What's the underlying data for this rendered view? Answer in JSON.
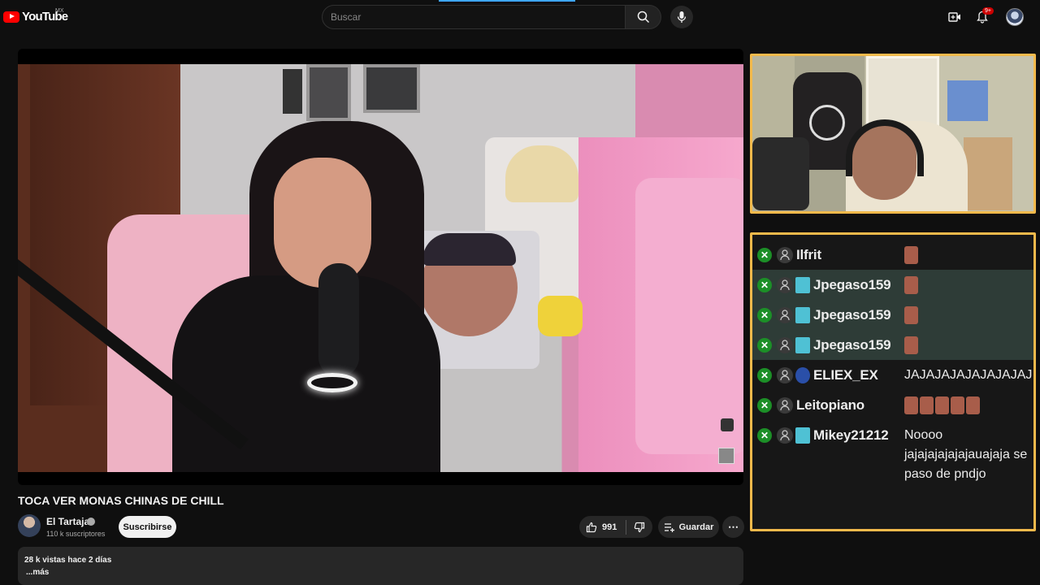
{
  "header": {
    "logo_text": "YouTube",
    "country_code": "MX",
    "search_placeholder": "Buscar",
    "notification_count": "9+"
  },
  "video": {
    "title": "TOCA VER MONAS CHINAS DE CHILL",
    "channel_name": "El Tartaja",
    "subscribers": "110 k suscriptores",
    "subscribe_label": "Suscribirse",
    "likes": "991",
    "save_label": "Guardar",
    "more_label": "⋯",
    "views": "28 k vistas  hace 2 días",
    "more_desc": "...más"
  },
  "chat": {
    "messages": [
      {
        "user": "Ilfrit",
        "badge": "none",
        "highlight": false,
        "text": "",
        "emotes": 1
      },
      {
        "user": "Jpegaso159",
        "badge": "sub",
        "highlight": true,
        "text": "",
        "emotes": 1
      },
      {
        "user": "Jpegaso159",
        "badge": "sub",
        "highlight": true,
        "text": "",
        "emotes": 1
      },
      {
        "user": "Jpegaso159",
        "badge": "sub",
        "highlight": true,
        "text": "",
        "emotes": 1
      },
      {
        "user": "ELIEX_EX",
        "badge": "blue",
        "highlight": false,
        "text": "JAJAJAJAJAJAJAJAJ",
        "emotes": 0
      },
      {
        "user": "Leitopiano",
        "badge": "none",
        "highlight": false,
        "text": "",
        "emotes": 5
      },
      {
        "user": "Mikey21212",
        "badge": "sub",
        "highlight": false,
        "text": "Noooo jajajajajajajauajaja se paso de pndjo",
        "emotes": 0
      }
    ]
  },
  "colors": {
    "accent_red": "#ff0000",
    "overlay_border": "#f2b94b",
    "chat_highlight": "#2e3c37",
    "xbox_green": "#1c8f27"
  }
}
